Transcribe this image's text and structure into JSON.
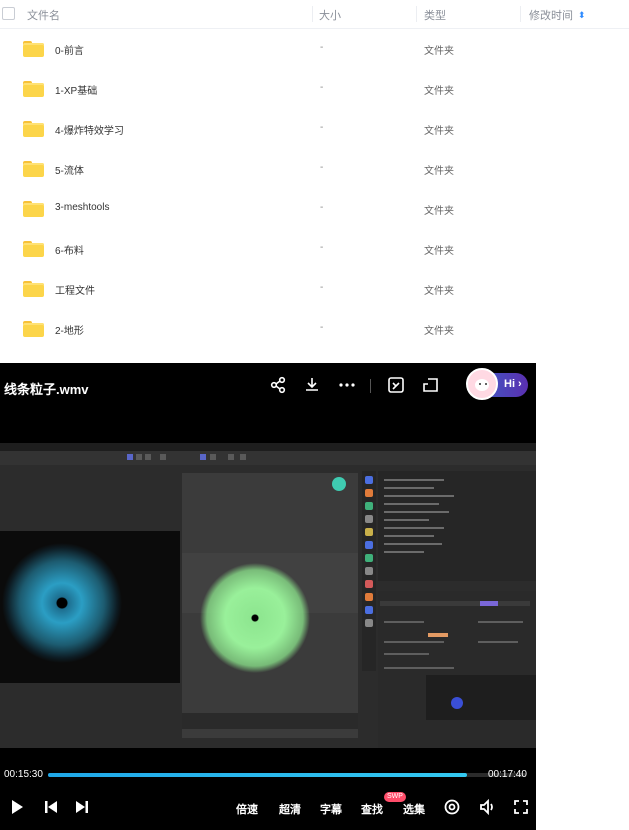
{
  "file_list": {
    "columns": [
      "文件名",
      "大小",
      "类型",
      "修改时间"
    ],
    "sort_indicator": "⬍",
    "rows": [
      {
        "name": "0-前言",
        "size": "-",
        "type": "文件夹"
      },
      {
        "name": "1-XP基础",
        "size": "-",
        "type": "文件夹"
      },
      {
        "name": "4-爆炸特效学习",
        "size": "-",
        "type": "文件夹"
      },
      {
        "name": "5-流体",
        "size": "-",
        "type": "文件夹"
      },
      {
        "name": "3-meshtools",
        "size": "-",
        "type": "文件夹"
      },
      {
        "name": "6-布料",
        "size": "-",
        "type": "文件夹"
      },
      {
        "name": "工程文件",
        "size": "-",
        "type": "文件夹"
      },
      {
        "name": "2-地形",
        "size": "-",
        "type": "文件夹"
      }
    ]
  },
  "player": {
    "title": "线条粒子.wmv",
    "hi_label": "Hi ›",
    "current_time": "00:15:30",
    "total_time": "00:17:40",
    "progress": 0.877,
    "controls": [
      "倍速",
      "超清",
      "字幕",
      "查找",
      "选集"
    ],
    "badge": "SWP",
    "colors": {
      "accent": "#1fa7e8",
      "badge": "#ff4d6a"
    }
  }
}
